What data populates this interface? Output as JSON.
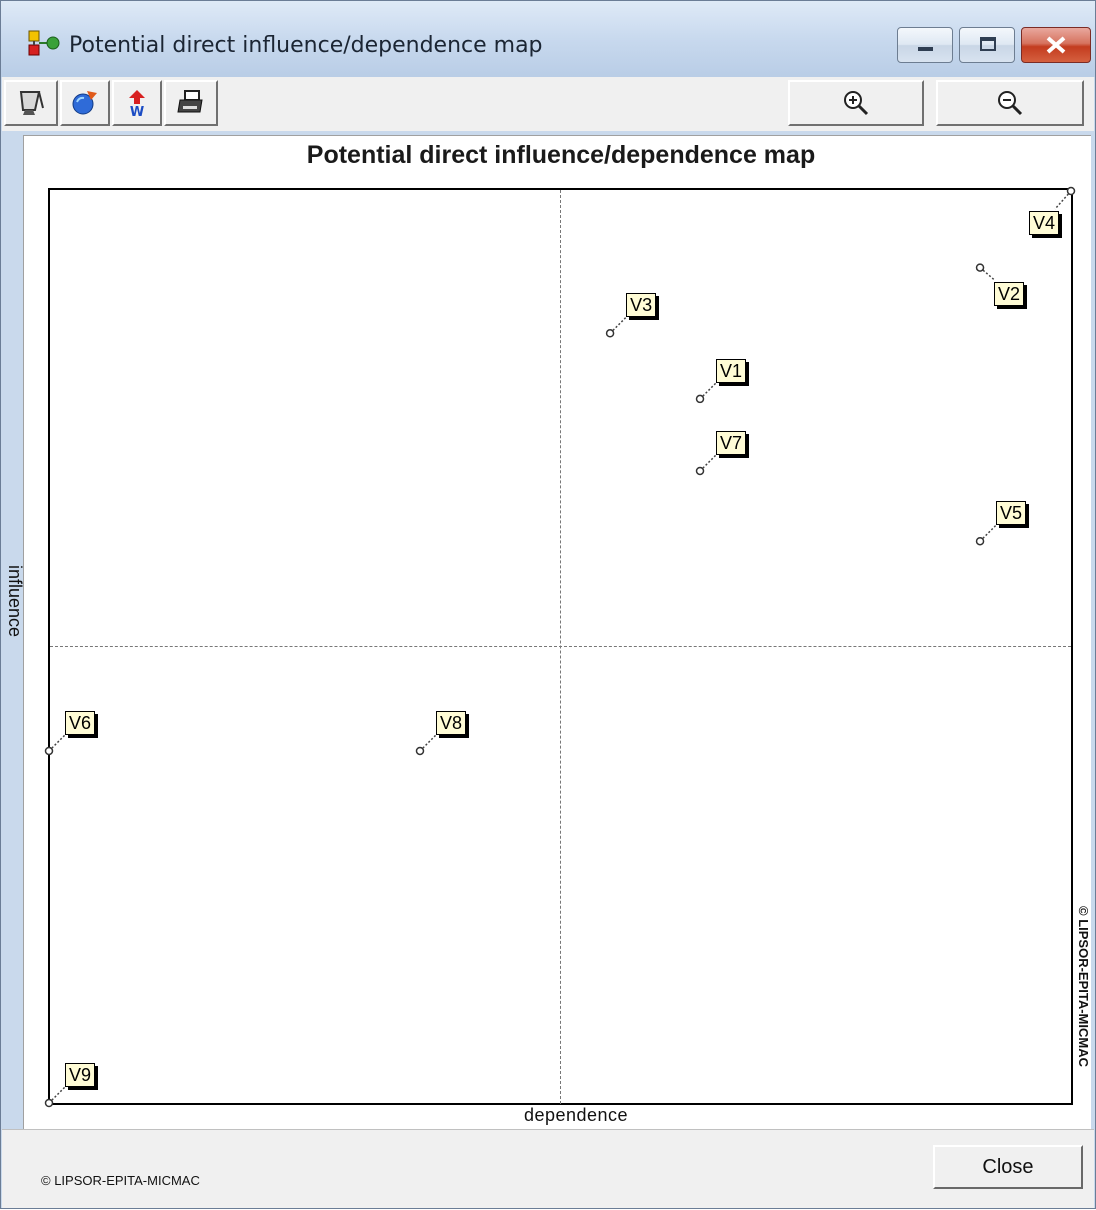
{
  "window": {
    "title": "Potential direct influence/dependence map"
  },
  "toolbar": {
    "left_buttons": [
      "copy-icon",
      "refresh-icon",
      "export-word-icon",
      "print-icon"
    ],
    "right_buttons": [
      "zoom-in-icon",
      "zoom-out-icon"
    ]
  },
  "colors": {
    "label_bg": "#fffcd6",
    "client_bg": "#ffffff",
    "chrome_bg": "#f0f0f0"
  },
  "chart_data": {
    "type": "scatter",
    "title": "Potential direct influence/dependence map",
    "xlabel": "dependence",
    "ylabel": "influence",
    "grid": false,
    "quadrant_lines": true,
    "points": [
      {
        "label": "V1",
        "dependence": 0.637,
        "influence": 0.772
      },
      {
        "label": "V2",
        "dependence": 0.911,
        "influence": 0.916
      },
      {
        "label": "V3",
        "dependence": 0.549,
        "influence": 0.844
      },
      {
        "label": "V4",
        "dependence": 1.0,
        "influence": 1.0
      },
      {
        "label": "V5",
        "dependence": 0.911,
        "influence": 0.616
      },
      {
        "label": "V6",
        "dependence": 0.0,
        "influence": 0.386
      },
      {
        "label": "V7",
        "dependence": 0.637,
        "influence": 0.693
      },
      {
        "label": "V8",
        "dependence": 0.363,
        "influence": 0.386
      },
      {
        "label": "V9",
        "dependence": 0.0,
        "influence": 0.0
      }
    ]
  },
  "watermark": {
    "side": "© LIPSOR-EPITA-MICMAC"
  },
  "footer": {
    "copyright": "© LIPSOR-EPITA-MICMAC",
    "close_label": "Close"
  }
}
